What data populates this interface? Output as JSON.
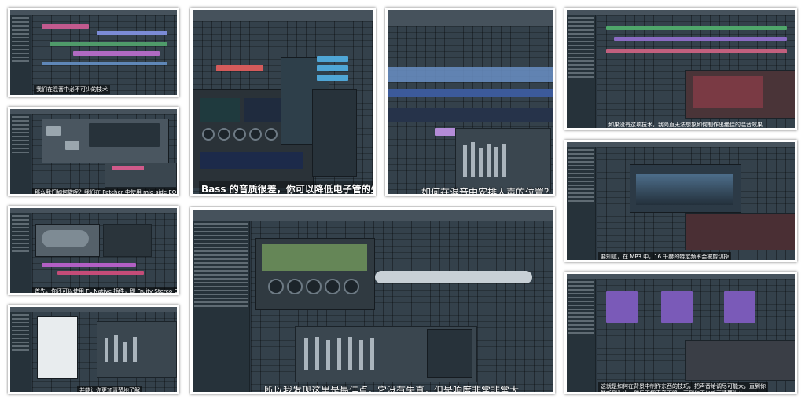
{
  "panels": [
    {
      "id": "p1",
      "caption": "所以我发现这里是最佳点，它没有失真，但是响度非常非常大"
    },
    {
      "id": "p2",
      "caption": "Bass 的音质很差，你可以降低电子管的失真度"
    },
    {
      "id": "p3",
      "caption": "如何在混音中安排人声的位置？"
    },
    {
      "id": "p4",
      "caption": "如果没有这项技术，我简直无法想象如何制作出绝佳的混音效果"
    },
    {
      "id": "p5",
      "caption": "要知道，在 MP3 中，16 千赫的特定频率会被剪切掉"
    },
    {
      "id": "p6",
      "caption": "这就是如何在背景中制作东西的技巧，把声音给调尽可能大，直到你能听到为止，然后再把声音下降，直到你再也听不清楚为止"
    },
    {
      "id": "p7",
      "caption": "我们在混音中必不可少的技术"
    },
    {
      "id": "p8",
      "caption": "那么我们如何做呢？我们在 Patcher 中使用 mid-side EQ 插件"
    },
    {
      "id": "p9",
      "caption": "首先，你还可以使用 FL Native 插件，即 Fruity Stereo Enhancer"
    },
    {
      "id": "p10",
      "caption": "并能让你更加清楚地了解"
    }
  ]
}
